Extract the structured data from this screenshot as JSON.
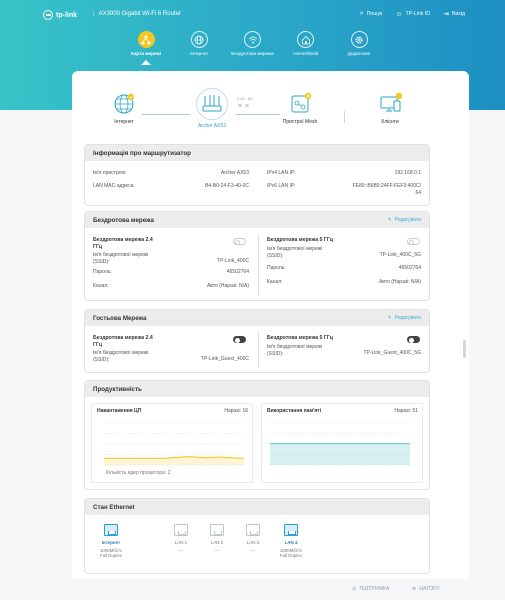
{
  "header": {
    "brand": "tp-link",
    "model": "AX3000 Gigabit Wi-Fi 6 Router",
    "search_label": "Пошук",
    "tplink_id_label": "TP-Link ID",
    "exit_label": "Вихід"
  },
  "nav": [
    {
      "label": "Карта мережі",
      "icon": "network-map-icon",
      "active": true
    },
    {
      "label": "Інтернет",
      "icon": "globe-icon",
      "active": false
    },
    {
      "label": "Бездротова мережа",
      "icon": "wifi-icon",
      "active": false
    },
    {
      "label": "HomeShield",
      "icon": "homeshield-icon",
      "active": false
    },
    {
      "label": "Додатково",
      "icon": "gear-icon",
      "active": false
    }
  ],
  "topology": {
    "internet_label": "Інтернет",
    "router_label": "Archer AX53",
    "mesh_label": "Пристрої Mesh",
    "clients_label": "Клієнти",
    "band_24": "2.4G",
    "band_5": "5G"
  },
  "router_info": {
    "title": "Інформація про маршрутизатор",
    "device_name_label": "Ім'я пристрою:",
    "device_name": "Archer AX53",
    "lan_mac_label": "LAN MAC-адреса:",
    "lan_mac": "B4-B0-24-F3-40-0C",
    "ipv4_label": "IPv4 LAN IP:",
    "ipv4": "192.168.0.1",
    "ipv6_label": "IPv6 LAN IP:",
    "ipv6_line1": "FE80::B6B0:24FF:FEF3:400C/",
    "ipv6_line2": "64"
  },
  "wireless": {
    "title": "Бездротова мережа",
    "edit_label": "Редагувати",
    "band24_title_1": "Бездротова мережа 2.4",
    "band24_title_2": "ГГц",
    "ssid_label_1": "Ім'я бездротової мережі",
    "ssid_label_2": "(SSID):",
    "band24_ssid": "TP-Link_400C",
    "password_label": "Пароль:",
    "band24_password": "46502764",
    "channel_label": "Канал:",
    "band24_channel": "Авто (Наразі: N/A)",
    "band5_title": "Бездротова мережа 5 ГГц",
    "band5_ssid": "TP-Link_400C_5G",
    "band5_password": "46502764",
    "band5_channel": "Авто (Наразі: N/A)"
  },
  "guest": {
    "title": "Гостьова Мережа",
    "edit_label": "Редагувати",
    "band24_title_1": "Бездротова мережа 2.4",
    "band24_title_2": "ГГц",
    "ssid_label_1": "Ім'я бездротової мережі",
    "ssid_label_2": "(SSID):",
    "band24_ssid": "TP-Link_Guest_400C",
    "band5_title": "Бездротова мережа 5 ГГц",
    "band5_ssid": "TP-Link_Guest_400C_5G"
  },
  "performance": {
    "title": "Продуктивність",
    "cpu_label": "Навантаження ЦП",
    "cpu_now_label": "Наразі:",
    "cpu_now": "16",
    "cpu_cores_label": "Кількість ядер процесора: 2",
    "mem_label": "Використання пам'яті",
    "mem_now_label": "Наразі:",
    "mem_now": "51"
  },
  "ethernet": {
    "title": "Стан Ethernet",
    "ports": [
      {
        "label": "Інтернет",
        "status_1": "1000Мбіт/с",
        "status_2": "Full Duplex",
        "on": true
      },
      {
        "label": "LAN 1",
        "status_1": "---",
        "status_2": "",
        "on": false
      },
      {
        "label": "LAN 2",
        "status_1": "---",
        "status_2": "",
        "on": false
      },
      {
        "label": "LAN 3",
        "status_1": "---",
        "status_2": "",
        "on": false
      },
      {
        "label": "LAN 4",
        "status_1": "1000Мбіт/с",
        "status_2": "Full Duplex",
        "on": true
      }
    ]
  },
  "footer": {
    "support_label": "ПІДТРИМКА",
    "top_label": "НАГОРУ"
  },
  "colors": {
    "accent": "#2aa7c9",
    "active_nav": "#f6c624",
    "cpu_line": "#f0c419",
    "mem_line": "#5fc9cc"
  },
  "chart_data": [
    {
      "type": "area",
      "title": "Навантаження ЦП",
      "series": [
        {
          "name": "",
          "values": [
            16,
            16,
            16,
            16,
            16,
            16,
            16,
            16,
            16,
            16,
            16,
            17,
            18,
            19,
            20,
            19,
            18,
            17,
            18,
            19,
            18,
            17,
            16,
            16
          ]
        }
      ],
      "ylim": [
        0,
        100
      ]
    },
    {
      "type": "area",
      "title": "Використання пам'яті",
      "series": [
        {
          "name": "",
          "values": [
            51,
            51,
            51,
            51,
            51,
            51,
            51,
            51,
            51,
            51,
            51,
            51
          ]
        }
      ],
      "ylim": [
        0,
        100
      ]
    }
  ]
}
